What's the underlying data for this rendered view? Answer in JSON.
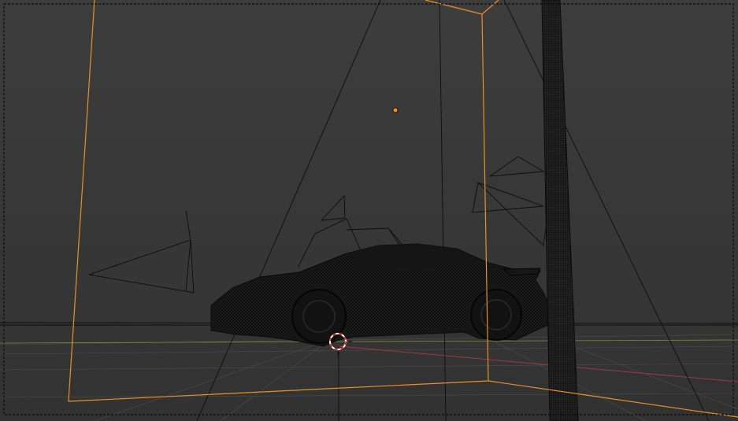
{
  "viewport": {
    "mode": "wireframe",
    "selected_object": "camera-frame",
    "background_colors": {
      "top": "#3d3d3d",
      "bottom": "#323232"
    },
    "colors": {
      "selection_outline": "#e8902a",
      "wire": "#0d0d0d",
      "grid": "#4d4d4d",
      "x_axis": "#9c3a46",
      "y_axis": "#7d8a3a",
      "passepartout": "#232323",
      "cursor_red": "#d72a2a",
      "cursor_white": "#ffffff"
    },
    "icons": {
      "cursor": "3d-cursor-icon",
      "origin": "object-origin-icon",
      "camera": "camera-frustum-icon",
      "car": "car-mesh-icon",
      "lights": "spot-light-icon"
    }
  }
}
